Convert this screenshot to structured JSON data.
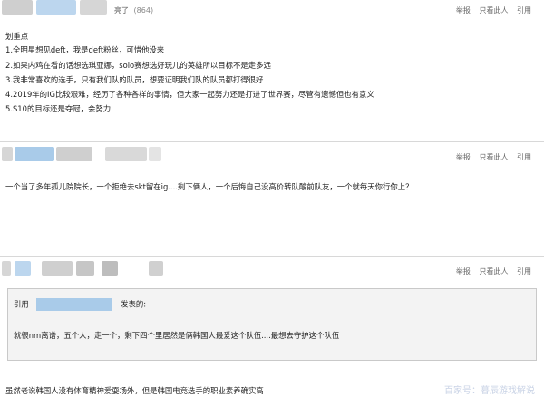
{
  "actions": {
    "report": "举报",
    "only_this_user": "只看此人",
    "quote": "引用"
  },
  "post1": {
    "title_fragment": "亮了",
    "likes": "(864)",
    "lines": [
      "划重点",
      "1.全明星想见deft，我是deft粉丝，可惜他没来",
      "2.如果内鸡在看的话想选琪亚娜，solo赛想选好玩儿的英雄所以目标不是走多远",
      "3.我非常喜欢的选手，只有我们队的队员，想要证明我们队的队员都打得很好",
      "4.2019年的IG比较艰难，经历了各种各样的事情，但大家一起努力还是打进了世界赛，尽管有遗憾但也有意义",
      "5.S10的目标还是夺冠，会努力"
    ]
  },
  "post2": {
    "text": "一个当了多年孤儿院院长，一个拒绝去skt留在ig....剩下俩人，一个后悔自己没高价转队酸前队友，一个就每天你行你上？"
  },
  "post3": {
    "quote_label": "引用",
    "quote_posted": "发表的:",
    "quote_text": "就很nm离谱，五个人，走一个，剩下四个里居然是俩韩国人最爱这个队伍....最想去守护这个队伍",
    "reply": "虽然老说韩国人没有体育精神爱耍场外，但是韩国电竞选手的职业素养确实高"
  },
  "watermark": "百家号：暮辰游戏解说",
  "colors": {
    "blur_blue": "#a9cbe9",
    "blur_gray": "#cfcfcf",
    "quote_bg": "#f3f3f3"
  }
}
